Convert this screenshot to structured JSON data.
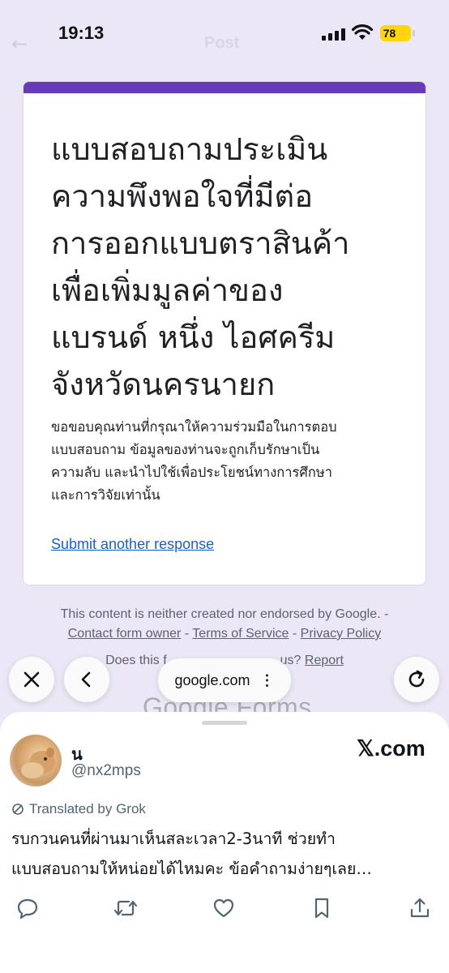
{
  "status_bar": {
    "time": "19:13",
    "battery": "78",
    "ghost_title": "Post"
  },
  "form": {
    "accent_color": "#673ab7",
    "title_lines": [
      "แบบสอบถามประเมิน",
      "ความพึงพอใจที่มีต่อ",
      "การออกแบบตราสินค้า",
      "เพื่อเพิ่มมูลค่าของ",
      "แบรนด์ หนึ่ง ไอศครีม",
      "จังหวัดนครนายก"
    ],
    "description_lines": [
      "ขอขอบคุณท่านที่กรุณาให้ความร่วมมือในการตอบ",
      "แบบสอบถาม ข้อมูลของท่านจะถูกเก็บรักษาเป็น",
      "ความลับ และนำไปใช้เพื่อประโยชน์ทางการศึกษา",
      "และการวิจัยเท่านั้น"
    ],
    "submit_link": "Submit another response"
  },
  "footer": {
    "disclaimer": "This content is neither created nor endorsed by Google. -",
    "contact": "Contact form owner",
    "terms": "Terms of Service",
    "privacy": "Privacy Policy",
    "sep": " - ",
    "abuse_prefix": "Does this f",
    "abuse_suffix": "us?",
    "report": "Report",
    "logo": "Google Forms"
  },
  "browser": {
    "url": "google.com",
    "close_icon": "close-icon",
    "back_icon": "chevron-left-icon",
    "reload_icon": "reload-icon"
  },
  "post": {
    "name": "น",
    "handle": "@nx2mps",
    "site": "𝕏.com",
    "translated_label": "Translated by Grok",
    "text_lines": [
      "รบกวนคนที่ผ่านมาเห็นสละเวลา2-3นาที ช่วยทำ",
      "แบบสอบถามให้หน่อยได้ไหมคะ ข้อคำถามง่ายๆเลย…"
    ],
    "actions": [
      "reply-icon",
      "repost-icon",
      "like-icon",
      "bookmark-icon",
      "share-icon"
    ]
  }
}
